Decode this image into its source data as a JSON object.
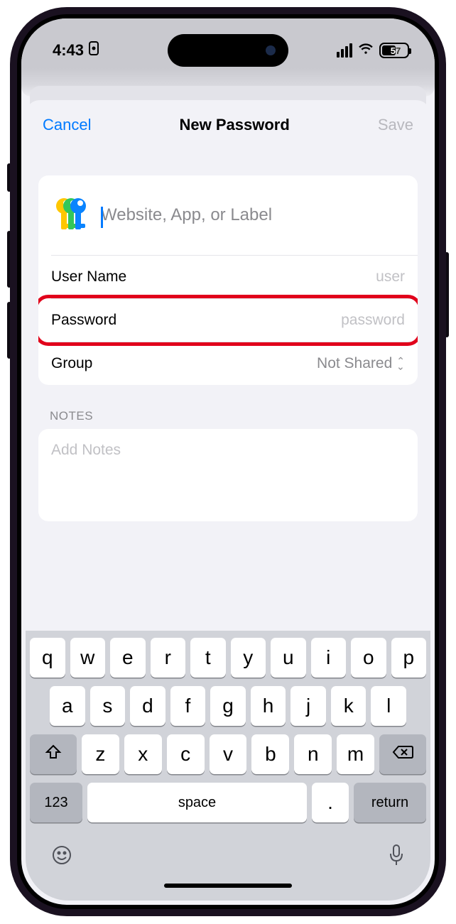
{
  "status": {
    "time": "4:43",
    "battery": "57",
    "battery_pct": 57
  },
  "nav": {
    "cancel": "Cancel",
    "title": "New Password",
    "save": "Save"
  },
  "form": {
    "title_placeholder": "Website, App, or Label",
    "username_label": "User Name",
    "username_placeholder": "user",
    "password_label": "Password",
    "password_placeholder": "password",
    "group_label": "Group",
    "group_value": "Not Shared"
  },
  "notes": {
    "header": "NOTES",
    "placeholder": "Add Notes"
  },
  "keyboard": {
    "row1": [
      "q",
      "w",
      "e",
      "r",
      "t",
      "y",
      "u",
      "i",
      "o",
      "p"
    ],
    "row2": [
      "a",
      "s",
      "d",
      "f",
      "g",
      "h",
      "j",
      "k",
      "l"
    ],
    "row3": [
      "z",
      "x",
      "c",
      "v",
      "b",
      "n",
      "m"
    ],
    "numbers": "123",
    "space": "space",
    "dot": ".",
    "return": "return"
  }
}
